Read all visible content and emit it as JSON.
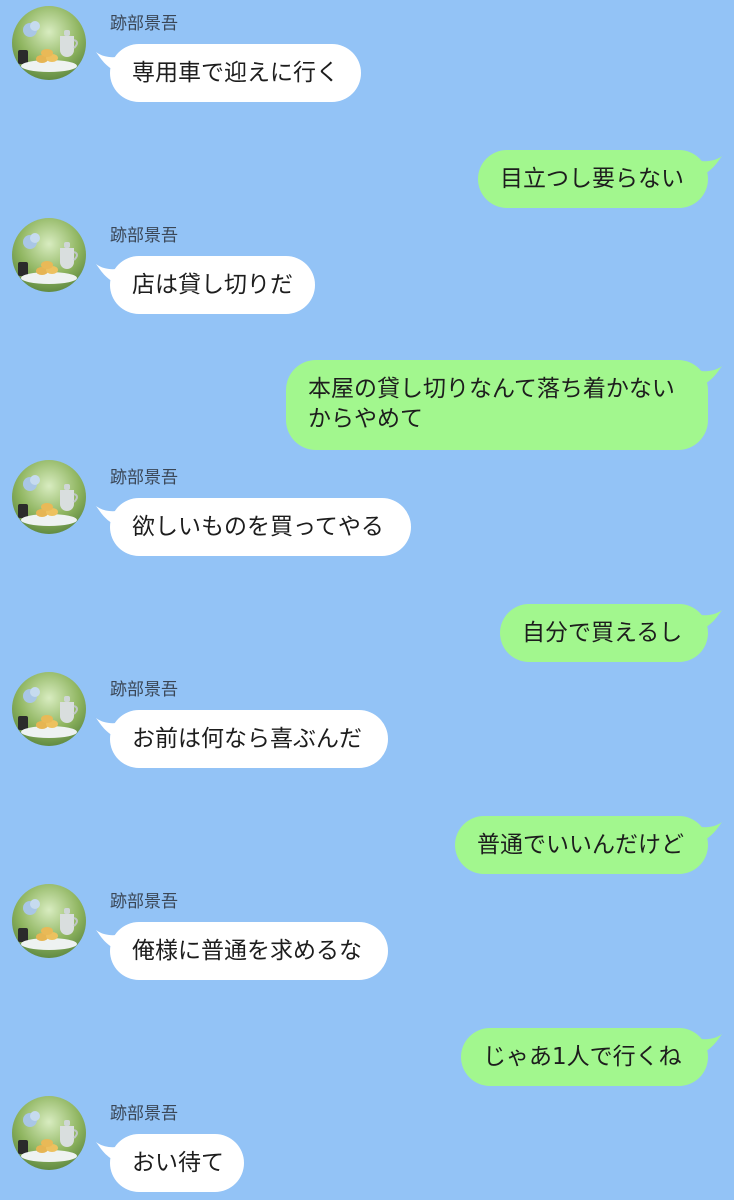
{
  "contact": {
    "name": "跡部景吾"
  },
  "colors": {
    "background": "#93c3f6",
    "incoming_bubble": "#ffffff",
    "outgoing_bubble": "#a2f78e"
  },
  "messages": [
    {
      "side": "in",
      "lines": [
        "専用車で迎えに行く"
      ]
    },
    {
      "side": "out",
      "lines": [
        "目立つし要らない"
      ]
    },
    {
      "side": "in",
      "lines": [
        "店は貸し切りだ"
      ]
    },
    {
      "side": "out",
      "lines": [
        "本屋の貸し切りなんて落ち着かない",
        "からやめて"
      ]
    },
    {
      "side": "in",
      "lines": [
        "欲しいものを買ってやる"
      ]
    },
    {
      "side": "out",
      "lines": [
        "自分で買えるし"
      ]
    },
    {
      "side": "in",
      "lines": [
        "お前は何なら喜ぶんだ"
      ]
    },
    {
      "side": "out",
      "lines": [
        "普通でいいんだけど"
      ]
    },
    {
      "side": "in",
      "lines": [
        "俺様に普通を求めるな"
      ]
    },
    {
      "side": "out",
      "lines": [
        "じゃあ1人で行くね"
      ]
    },
    {
      "side": "in",
      "lines": [
        "おい待て"
      ]
    }
  ]
}
